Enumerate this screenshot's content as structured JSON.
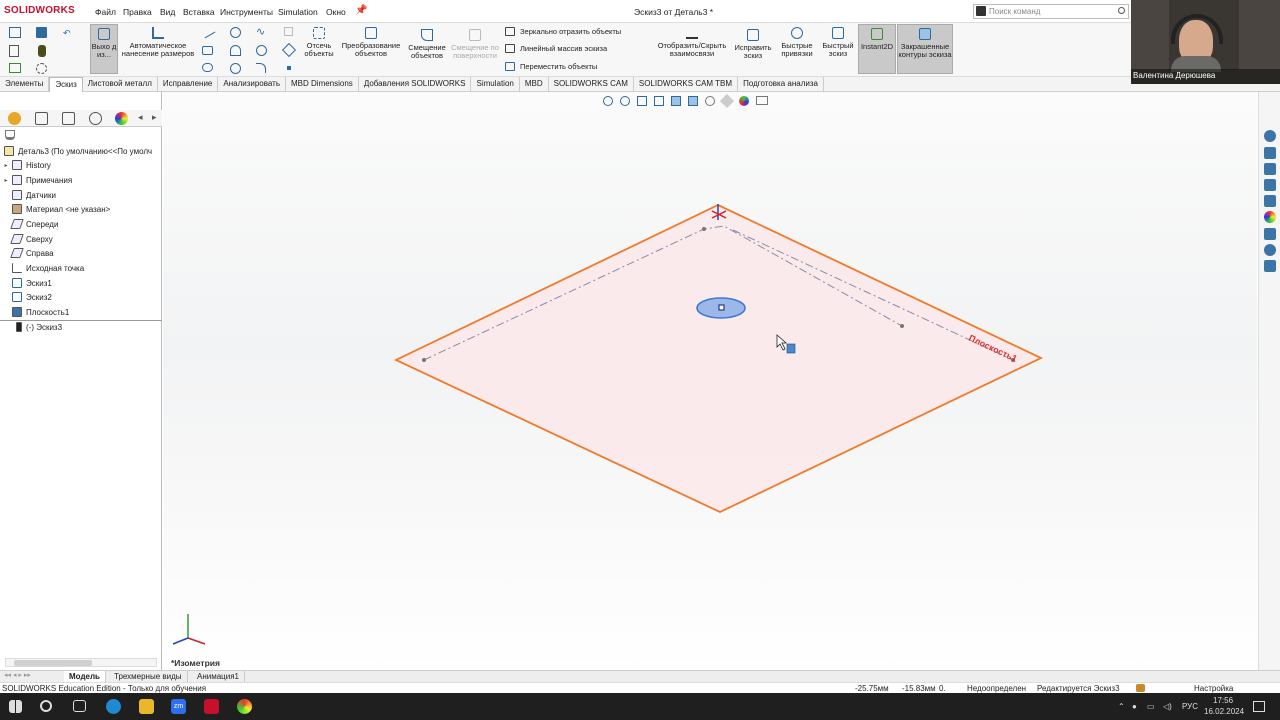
{
  "app": {
    "logo": "SOLIDWORKS",
    "doc_title": "Эскиз3 от Деталь3 *"
  },
  "menu": [
    "Файл",
    "Правка",
    "Вид",
    "Вставка",
    "Инструменты",
    "Simulation",
    "Окно"
  ],
  "search": {
    "placeholder": "Поиск команд"
  },
  "ribbon": {
    "exit_sketch": "Выхо д из...",
    "smart_dim": "Автоматическое нанесение размеров",
    "trim": "Отсечь объекты",
    "convert": "Преобразование объектов",
    "offset": "Смещение объектов",
    "offset_surface": "Смещение по поверхности",
    "mirror": "Зеркально отразить объекты",
    "linear_pattern": "Линейный массив эскиза",
    "move": "Переместить объекты",
    "show_relations": "Отобразить/Скрыть взаимосвязи",
    "repair": "Исправить эскиз",
    "quick_snaps": "Быстрые привязки",
    "rapid_sketch": "Быстрый эскиз",
    "instant2d": "Instant2D",
    "shaded_contours": "Закрашенные контуры эскиза"
  },
  "tabs": [
    "Элементы",
    "Эскиз",
    "Листовой металл",
    "Исправление",
    "Анализировать",
    "MBD Dimensions",
    "Добавления SOLIDWORKS",
    "Simulation",
    "MBD",
    "SOLIDWORKS CAM",
    "SOLIDWORKS CAM TBM",
    "Подготовка анализа"
  ],
  "active_tab": "Эскиз",
  "tree": {
    "root": "Деталь3  (По умолчанию<<По умолч",
    "items": [
      "History",
      "Примечания",
      "Датчики",
      "Материал <не указан>",
      "Спереди",
      "Сверху",
      "Справа",
      "Исходная точка",
      "Эскиз1",
      "Эскиз2",
      "Плоскость1",
      "(-) Эскиз3"
    ]
  },
  "viewport": {
    "view_label": "*Изометрия",
    "plane_label": "Плоскость1"
  },
  "bottom_tabs": [
    "Модель",
    "Трехмерные виды",
    "Анимация1"
  ],
  "status": {
    "edition": "SOLIDWORKS Education Edition - Только для обучения",
    "x": "-25.75мм",
    "y": "-15.83мм",
    "z": "0.",
    "state": "Недоопределен",
    "editing": "Редактируется Эскиз3",
    "settings": "Настройка"
  },
  "taskbar": {
    "lang": "РУС",
    "time": "17:56",
    "date": "16.02.2024"
  },
  "webcam": {
    "name": "Валентина Дерюшева"
  },
  "colors": {
    "accent": "#2f6a9e",
    "plane_edge": "#f07a2a",
    "plane_fill": "#fbe9ea",
    "brand": "#c8102e"
  }
}
